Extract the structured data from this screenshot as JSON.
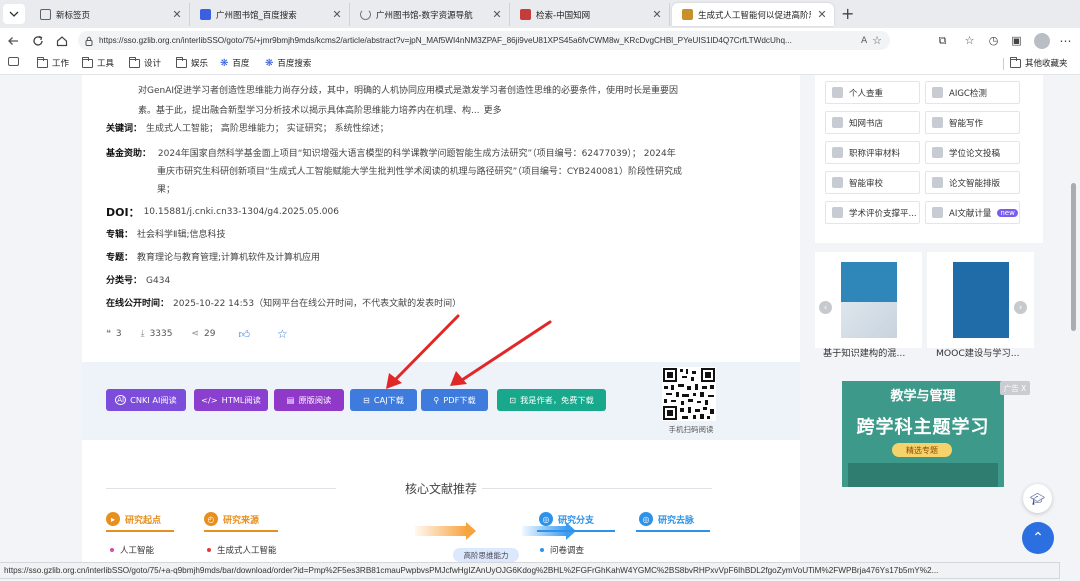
{
  "browser": {
    "tabs": [
      {
        "title": "新标签页",
        "favicon_color": "#5a6270",
        "active": false
      },
      {
        "title": "广州图书馆_百度搜索",
        "favicon_color": "#3a5fe0",
        "active": false
      },
      {
        "title": "广州图书馆-数字资源导航",
        "favicon_color": "#777777",
        "active": false
      },
      {
        "title": "检索-中国知网",
        "favicon_color": "#c43c3c",
        "active": false
      },
      {
        "title": "生成式人工智能何以促进高阶思维",
        "favicon_color": "#c8902a",
        "active": true
      }
    ],
    "url": "https://sso.gzlib.org.cn/interlibSSO/goto/75/+jmr9bmjh9mds/kcms2/article/abstract?v=jpN_MAf5WI4nNM3ZPAF_86ji9veU81XPS45a6fvCWM8w_KRcDvgCHBl_PYeUIS1lD4Q7CrfLTWdcUhq...",
    "bookmarks": [
      "工作",
      "工具",
      "设计",
      "娱乐",
      "百度",
      "百度搜索"
    ],
    "other_bookmarks": "其他收藏夹",
    "status_url": "https://sso.gzlib.org.cn/interlibSSO/goto/75/+a-q9bmjh9mds/bar/download/order?id=Pmp%2F5es3RB81cmauPwpbvsPMJcfwHgIZAnUyOJG6Kdog%2BHL%2FGFrGhKahW4YGMC%2BS8bvRHPxvVpF6IhBDL2fgoZymVoUTiM%2FWPBrja476Ys17b5mY%2..."
  },
  "article": {
    "abstract_line1": "对GenAI促进学习者创造性思维能力尚存分歧，其中，明确的人机协同应用模式是激发学习者创造性思维的必要条件，使用时长是重要因",
    "abstract_line2": "素。基于此，提出融合新型学习分析技术以揭示具体高阶思维能力培养内在机理、构...",
    "more_label": "更多",
    "keywords_label": "关键词：",
    "keywords": "生成式人工智能；  高阶思维能力；  实证研究；  系统性综述；",
    "fund_label": "基金资助：",
    "fund_line1": "2024年国家自然科学基金面上项目“知识增强大语言模型的科学课教学问题智能生成方法研究”（项目编号：62477039）；     2024年",
    "fund_line2": "重庆市研究生科研创新项目“生成式人工智能赋能大学生批判性学术阅读的机理与路径研究”（项目编号：CYB240081）阶段性研究成",
    "fund_line3": "果；",
    "doi_label": "DOI：",
    "doi": "10.15881/j.cnki.cn33-1304/g4.2025.05.006",
    "series_label": "专辑：",
    "series": "社会科学Ⅱ辑;信息科技",
    "topic_label": "专题：",
    "topic": "教育理论与教育管理;计算机软件及计算机应用",
    "class_label": "分类号：",
    "class": "G434",
    "online_label": "在线公开时间：",
    "online": "2025-10-22 14:53（知网平台在线公开时间，不代表文献的发表时间）",
    "quotes": "3",
    "downloads": "3335",
    "shares": "29"
  },
  "download": {
    "buttons": [
      {
        "label": "CNKI AI阅读",
        "color": "#7c4ddb"
      },
      {
        "label": "HTML阅读",
        "color": "#8a3fcf"
      },
      {
        "label": "原版阅读",
        "color": "#9038c8"
      },
      {
        "label": "CAJ下载",
        "color": "#3e7bdc"
      },
      {
        "label": "PDF下载",
        "color": "#3e7bdc"
      },
      {
        "label": "我是作者，免费下载",
        "color": "#18a98d"
      }
    ],
    "qr_caption": "手机扫码阅读"
  },
  "recommend": {
    "title": "核心文献推荐",
    "col1": {
      "heading": "研究起点",
      "item": "人工智能",
      "color": "#e7901f"
    },
    "col2": {
      "heading": "研究来源",
      "item": "生成式人工智能",
      "color": "#e7901f"
    },
    "col3": {
      "heading": "研究分支",
      "item": "问卷调查",
      "color": "#2d92e8"
    },
    "col4": {
      "heading": "研究去脉",
      "color": "#2d92e8"
    },
    "hot": "高阶思维能力"
  },
  "sidebar": {
    "tools": [
      "个人查重",
      "AIGC检测",
      "知网书店",
      "智能写作",
      "职称评审材料",
      "学位论文投稿",
      "智能审校",
      "论文智能排版",
      "学术评价支撑平...",
      "AI文献计量"
    ],
    "new_badge": "new",
    "books": [
      "基于知识建构的混...",
      "MOOC建设与学习..."
    ],
    "ad_brand": "教学与管理",
    "ad_title": "跨学科主题学习",
    "ad_pill": "精选专题",
    "ad_tag": "广告 X"
  }
}
